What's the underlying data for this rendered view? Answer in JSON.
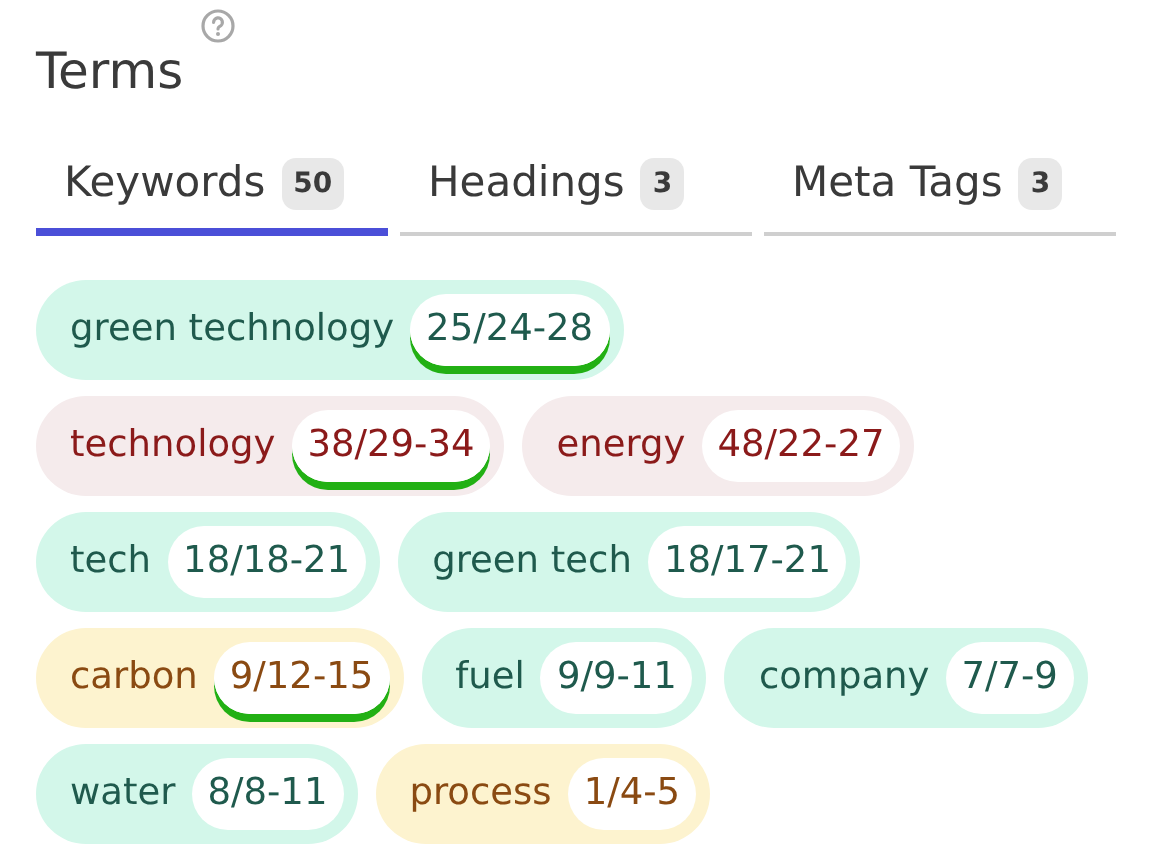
{
  "title": "Terms",
  "tabs": [
    {
      "label": "Keywords",
      "count": "50",
      "selected": true
    },
    {
      "label": "Headings",
      "count": "3",
      "selected": false
    },
    {
      "label": "Meta Tags",
      "count": "3",
      "selected": false
    }
  ],
  "term_rows": [
    [
      {
        "term": "green technology",
        "usage": "25/24-28",
        "kind": "good",
        "underlined": true
      }
    ],
    [
      {
        "term": "technology",
        "usage": "38/29-34",
        "kind": "over",
        "underlined": true
      },
      {
        "term": "energy",
        "usage": "48/22-27",
        "kind": "over",
        "underlined": false
      }
    ],
    [
      {
        "term": "tech",
        "usage": "18/18-21",
        "kind": "good",
        "underlined": false
      },
      {
        "term": "green tech",
        "usage": "18/17-21",
        "kind": "good",
        "underlined": false
      }
    ],
    [
      {
        "term": "carbon",
        "usage": "9/12-15",
        "kind": "under",
        "underlined": true
      },
      {
        "term": "fuel",
        "usage": "9/9-11",
        "kind": "good",
        "underlined": false
      },
      {
        "term": "company",
        "usage": "7/7-9",
        "kind": "good",
        "underlined": false
      }
    ],
    [
      {
        "term": "water",
        "usage": "8/8-11",
        "kind": "good",
        "underlined": false
      },
      {
        "term": "process",
        "usage": "1/4-5",
        "kind": "under",
        "underlined": false
      }
    ]
  ]
}
